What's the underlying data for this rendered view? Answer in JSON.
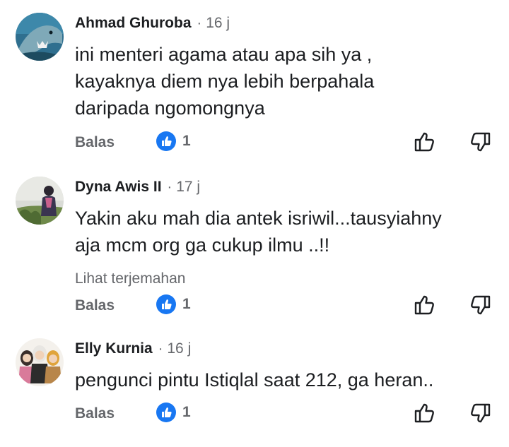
{
  "colors": {
    "like_blue": "#1877f2",
    "secondary_text": "#65676b",
    "primary_text": "#1c1e21"
  },
  "comments": [
    {
      "author": "Ahmad Ghuroba",
      "separator": "·",
      "time": "16 j",
      "avatar_icon": "shark-avatar",
      "lines": [
        "ini menteri agama atau apa sih ya ,",
        "kayaknya diem nya lebih berpahala",
        "daripada ngomongnya"
      ],
      "reply_label": "Balas",
      "like_count": "1"
    },
    {
      "author": "Dyna Awis II",
      "separator": "·",
      "time": "17 j",
      "avatar_icon": "person-photo-avatar",
      "lines": [
        "Yakin aku mah dia antek isriwil...tausyiahny",
        "aja mcm org ga cukup ilmu ..!!"
      ],
      "translate_label": "Lihat terjemahan",
      "reply_label": "Balas",
      "like_count": "1"
    },
    {
      "author": "Elly Kurnia",
      "separator": "·",
      "time": "16 j",
      "avatar_icon": "hijab-cartoon-avatar",
      "lines": [
        "pengunci pintu Istiqlal saat 212, ga heran.."
      ],
      "reply_label": "Balas",
      "like_count": "1"
    }
  ]
}
